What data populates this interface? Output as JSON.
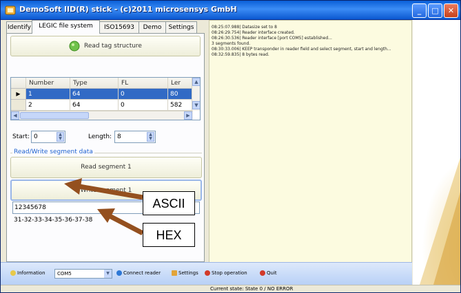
{
  "window": {
    "title": "DemoSoft IID(R) stick - (c)2011 microsensys GmbH"
  },
  "tabs": [
    {
      "label": "Identify"
    },
    {
      "label": "LEGIC file system",
      "active": true
    },
    {
      "label": "ISO15693"
    },
    {
      "label": "Demo"
    },
    {
      "label": "Settings"
    }
  ],
  "legic": {
    "read_structure_button": "Read tag structure",
    "grid": {
      "columns": [
        "Number",
        "Type",
        "FL",
        "Ler"
      ],
      "rows": [
        {
          "number": "1",
          "type": "64",
          "fl": "0",
          "len": "80"
        },
        {
          "number": "2",
          "type": "64",
          "fl": "0",
          "len": "582"
        }
      ]
    },
    "start_label": "Start:",
    "start_value": "0",
    "length_label": "Length:",
    "length_value": "8",
    "group_title": "Read/Write segment data",
    "read_segment_button": "Read segment 1",
    "write_segment_button": "Write segment 1",
    "ascii_value": "12345678",
    "hex_value": "31-32-33-34-35-36-37-38"
  },
  "log": [
    "08:25:07.988| Datasize set to 8",
    "08:26:29.754| Reader interface created.",
    "08:26:30.536| Reader interface [port COM5] established...",
    "3 segments found.",
    "08:30:33.006| KEEP transponder in reader field and select segment, start and length...",
    "08:32:59.835| 8 bytes read."
  ],
  "toolbar": {
    "information": "Information",
    "port": "COM5",
    "connect": "Connect reader",
    "settings": "Settings",
    "stop": "Stop operation",
    "quit": "Quit"
  },
  "status": {
    "text": "Current state: State 0 / NO ERROR"
  },
  "callouts": {
    "ascii": "ASCII",
    "hex": "HEX"
  },
  "colors": {
    "arrow": "#94501f",
    "selection": "#316ac5",
    "group_title": "#1f62d0"
  }
}
